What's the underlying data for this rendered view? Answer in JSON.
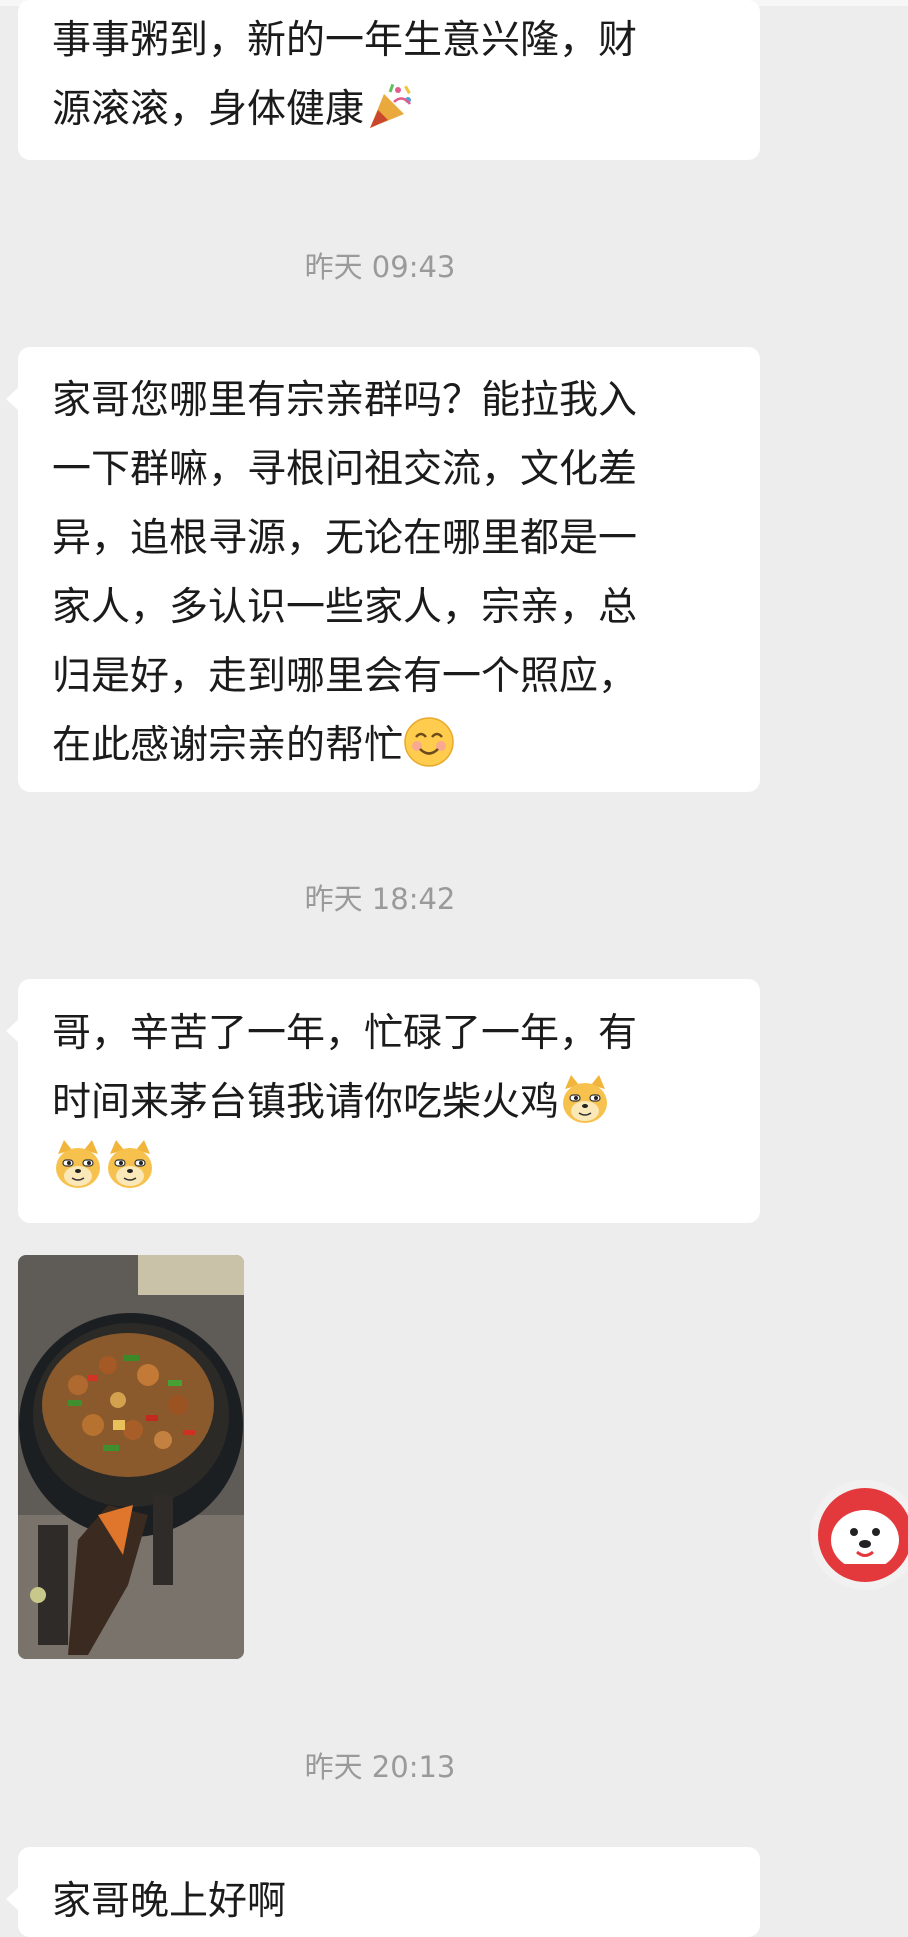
{
  "messages": [
    {
      "type": "text",
      "lines": [
        "事事粥到，新的一年生意兴隆，财",
        "源滚滚，身体健康"
      ],
      "emoji_end": "party-popper"
    },
    {
      "type": "time",
      "text": "昨天 09:43"
    },
    {
      "type": "text",
      "lines": [
        "家哥您哪里有宗亲群吗？能拉我入",
        "一下群嘛，寻根问祖交流，文化差",
        "异，追根寻源，无论在哪里都是一",
        "家人，多认识一些家人，宗亲，总",
        "归是好，走到哪里会有一个照应，",
        "在此感谢宗亲的帮忙"
      ],
      "emoji_end": "smiling-face"
    },
    {
      "type": "time",
      "text": "昨天 18:42"
    },
    {
      "type": "text",
      "lines": [
        "哥，辛苦了一年，忙碌了一年，有",
        "时间来茅台镇我请你吃柴火鸡"
      ],
      "emoji": [
        "doge",
        "doge",
        "doge"
      ]
    },
    {
      "type": "image",
      "subject": "firewood-chicken-in-wok"
    },
    {
      "type": "time",
      "text": "昨天 20:13"
    },
    {
      "type": "text",
      "lines": [
        "家哥晚上好啊"
      ]
    }
  ],
  "colors": {
    "background": "#ededed",
    "bubble": "#ffffff",
    "time": "#9a9a9a",
    "text": "#1b1b1b",
    "float_button_accent": "#e4393c"
  }
}
